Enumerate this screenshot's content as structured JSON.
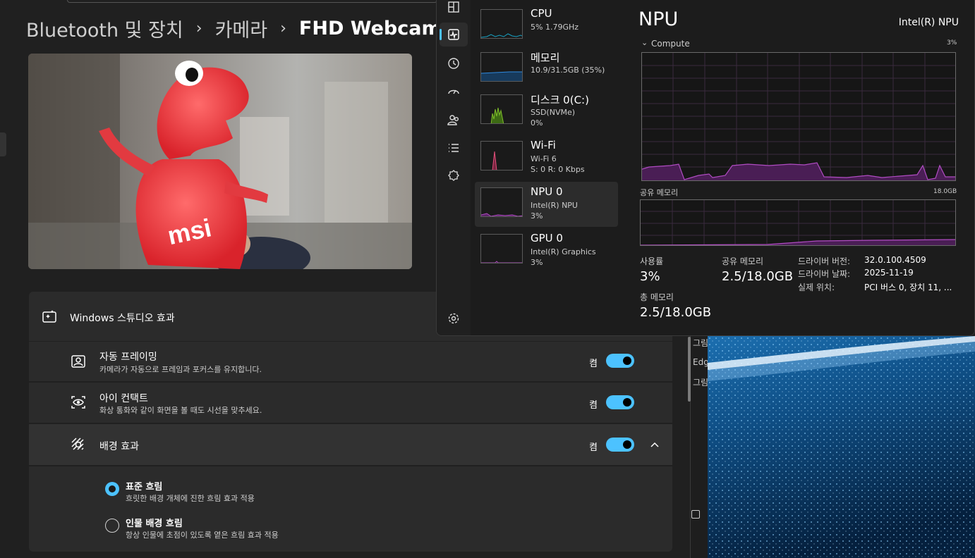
{
  "settings": {
    "breadcrumb": [
      "Bluetooth 및 장치",
      "카메라",
      "FHD Webcam"
    ],
    "breadcrumb_sep": "›",
    "preview_text": "msi",
    "studio_effects": {
      "title": "Windows 스튜디오 효과"
    },
    "auto_framing": {
      "title": "자동 프레이밍",
      "subtitle": "카메라가 자동으로 프레임과 포커스를 유지합니다.",
      "state": "켬"
    },
    "eye_contact": {
      "title": "아이 컨택트",
      "subtitle": "화상 통화와 같이 화면을 볼 때도 시선을 맞추세요.",
      "state": "켬"
    },
    "background_effects": {
      "title": "배경 효과",
      "state": "켬",
      "options": [
        {
          "title": "표준 흐림",
          "subtitle": "흐릿한 배경 개체에 진한 흐림 효과 적용",
          "selected": true
        },
        {
          "title": "인물 배경 흐림",
          "subtitle": "항상 인물에 초점이 있도록 옅은 흐림 효과 적용",
          "selected": false
        }
      ]
    }
  },
  "taskmgr": {
    "rail_icons": [
      "processes-icon",
      "performance-icon",
      "app-history-icon",
      "startup-apps-icon",
      "users-icon",
      "details-icon",
      "services-icon",
      "settings-icon"
    ],
    "devices": [
      {
        "name": "CPU",
        "sub1": "5% 1.79GHz",
        "sub2": "",
        "color": "#17a2c4"
      },
      {
        "name": "메모리",
        "sub1": "10.9/31.5GB (35%)",
        "sub2": "",
        "color": "#2f8ae0"
      },
      {
        "name": "디스크 0(C:)",
        "sub1": "SSD(NVMe)",
        "sub2": "0%",
        "color": "#7fbe2a"
      },
      {
        "name": "Wi-Fi",
        "sub1": "Wi-Fi 6",
        "sub2": "S: 0 R: 0 Kbps",
        "color": "#e0507a"
      },
      {
        "name": "NPU 0",
        "sub1": "Intel(R) NPU",
        "sub2": "3%",
        "color": "#b04cc2"
      },
      {
        "name": "GPU 0",
        "sub1": "Intel(R) Graphics",
        "sub2": "3%",
        "color": "#b04cc2"
      }
    ],
    "detail": {
      "title": "NPU",
      "model": "Intel(R) NPU",
      "compute_label": "Compute",
      "compute_max": "3%",
      "shared_mem_label": "공유 메모리",
      "shared_mem_max": "18.0GB",
      "usage_label": "사용률",
      "usage_value": "3%",
      "shared_label": "공유 메모리",
      "shared_value": "2.5/18.0GB",
      "total_label": "총 메모리",
      "total_value": "2.5/18.0GB",
      "driver_version_label": "드라이버 버전:",
      "driver_version": "32.0.100.4509",
      "driver_date_label": "드라이버 날짜:",
      "driver_date": "2025-11-19",
      "location_label": "실제 위치:",
      "location": "PCI 버스 0, 장치 11, ...",
      "accent": "#b04cc2"
    }
  },
  "side": {
    "texts": [
      "그림",
      "Edg",
      "그림"
    ]
  }
}
